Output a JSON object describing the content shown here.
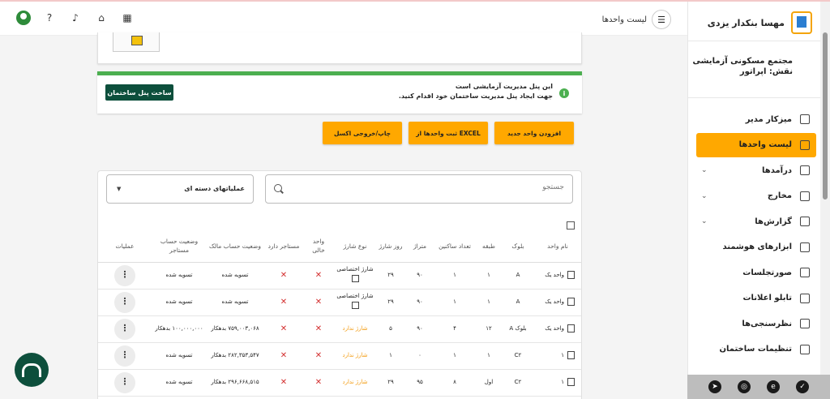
{
  "header": {
    "title": "لیست واحدها"
  },
  "sidebar": {
    "brand_name": "مهسا بنکدار یزدی",
    "complex_name": "مجتمع مسکونی آزمایشی",
    "role": "نقش: اپراتور",
    "items": [
      {
        "label": "میزکار مدیر",
        "active": false,
        "expandable": false
      },
      {
        "label": "لیست واحدها",
        "active": true,
        "expandable": false
      },
      {
        "label": "درآمدها",
        "active": false,
        "expandable": true
      },
      {
        "label": "مخارج",
        "active": false,
        "expandable": true
      },
      {
        "label": "گزارش‌ها",
        "active": false,
        "expandable": true
      },
      {
        "label": "ابزارهای هوشمند",
        "active": false,
        "expandable": false
      },
      {
        "label": "صورتجلسات",
        "active": false,
        "expandable": false
      },
      {
        "label": "تابلو اعلانات",
        "active": false,
        "expandable": false
      },
      {
        "label": "نظرسنجی‌ها",
        "active": false,
        "expandable": false
      },
      {
        "label": "تنظیمات ساختمان",
        "active": false,
        "expandable": false
      }
    ]
  },
  "alert": {
    "line1": "این پنل مدیریت آزمایشی است",
    "line2": "جهت ایجاد پنل مدیریت ساختمان خود اقدام کنید.",
    "button": "ساخت پنل ساختمان"
  },
  "actions": {
    "add_unit": "افزودن واحد جدید",
    "import_excel": "ثبت واحدها از EXCEL",
    "print_export": "چاپ/خروجی اکسل"
  },
  "table_tools": {
    "search_placeholder": "جستجو",
    "bulk_actions": "عملیاتهای دسته ای"
  },
  "table": {
    "headers": [
      "نام واحد",
      "بلوک",
      "طبقه",
      "تعداد ساکنین",
      "متراژ",
      "روز شارژ",
      "نوع شارژ",
      "واحد خالی",
      "مستاجر دارد",
      "وضعیت حساب مالک",
      "وضعیت حساب مستاجر",
      "عملیات"
    ],
    "rows": [
      {
        "name": "واحد یک",
        "block": "A",
        "floor": "۱",
        "residents": "۱",
        "area": "۹۰",
        "charge_day": "۲۹",
        "charge_type": "شارژ اختصاصی",
        "charge_type_link": false,
        "show_edit": true,
        "owner": "تسویه شده",
        "tenant": "تسویه شده"
      },
      {
        "name": "واحد یک",
        "block": "A",
        "floor": "۱",
        "residents": "۱",
        "area": "۹۰",
        "charge_day": "۲۹",
        "charge_type": "شارژ اختصاصی",
        "charge_type_link": false,
        "show_edit": true,
        "owner": "تسویه شده",
        "tenant": "تسویه شده"
      },
      {
        "name": "واحد یک",
        "block": "بلوک A",
        "floor": "۱۲",
        "residents": "۴",
        "area": "۹۰",
        "charge_day": "۵",
        "charge_type": "شارژ ندارد",
        "charge_type_link": true,
        "show_edit": false,
        "owner": "۷۵۹,۰۰۳,۰۶۸ بدهکار",
        "tenant": "۱۰۰,۰۰۰,۰۰۰ بدهکار"
      },
      {
        "name": "۱",
        "block": "C۲",
        "floor": "۱",
        "residents": "۱",
        "area": "۰",
        "charge_day": "۱",
        "charge_type": "شارژ ندارد",
        "charge_type_link": true,
        "show_edit": false,
        "owner": "۲۸۲,۳۵۳,۵۴۷ بدهکار",
        "tenant": "تسویه شده"
      },
      {
        "name": "۱",
        "block": "C۲",
        "floor": "اول",
        "residents": "۸",
        "area": "۹۵",
        "charge_day": "۲۹",
        "charge_type": "شارژ ندارد",
        "charge_type_link": true,
        "show_edit": false,
        "owner": "۲۹۶,۶۶۸,۵۱۵ بدهکار",
        "tenant": "تسویه شده"
      }
    ]
  },
  "colors": {
    "accent": "#ffa800",
    "dark_green": "#0d4f3c",
    "success": "#4caf50",
    "danger": "#d32f2f"
  }
}
